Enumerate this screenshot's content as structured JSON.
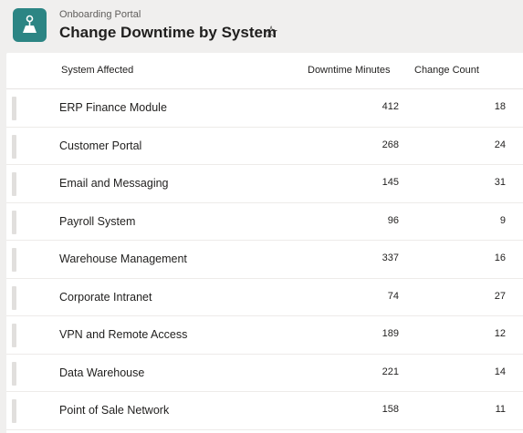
{
  "header": {
    "subtitle": "Onboarding Portal",
    "title": "Change Downtime by System",
    "star_glyph": "☆",
    "app_icon": "flask-icon",
    "app_color": "#2c8584"
  },
  "table": {
    "columns": {
      "system": "System Affected",
      "minutes": "Downtime Minutes",
      "count": "Change Count"
    },
    "rows": [
      {
        "system": "ERP Finance Module",
        "minutes": "412",
        "count": "18"
      },
      {
        "system": "Customer Portal",
        "minutes": "268",
        "count": "24"
      },
      {
        "system": "Email and Messaging",
        "minutes": "145",
        "count": "31"
      },
      {
        "system": "Payroll System",
        "minutes": "96",
        "count": "9"
      },
      {
        "system": "Warehouse Management",
        "minutes": "337",
        "count": "16"
      },
      {
        "system": "Corporate Intranet",
        "minutes": "74",
        "count": "27"
      },
      {
        "system": "VPN and Remote Access",
        "minutes": "189",
        "count": "12"
      },
      {
        "system": "Data Warehouse",
        "minutes": "221",
        "count": "14"
      },
      {
        "system": "Point of Sale Network",
        "minutes": "158",
        "count": "11"
      }
    ]
  }
}
